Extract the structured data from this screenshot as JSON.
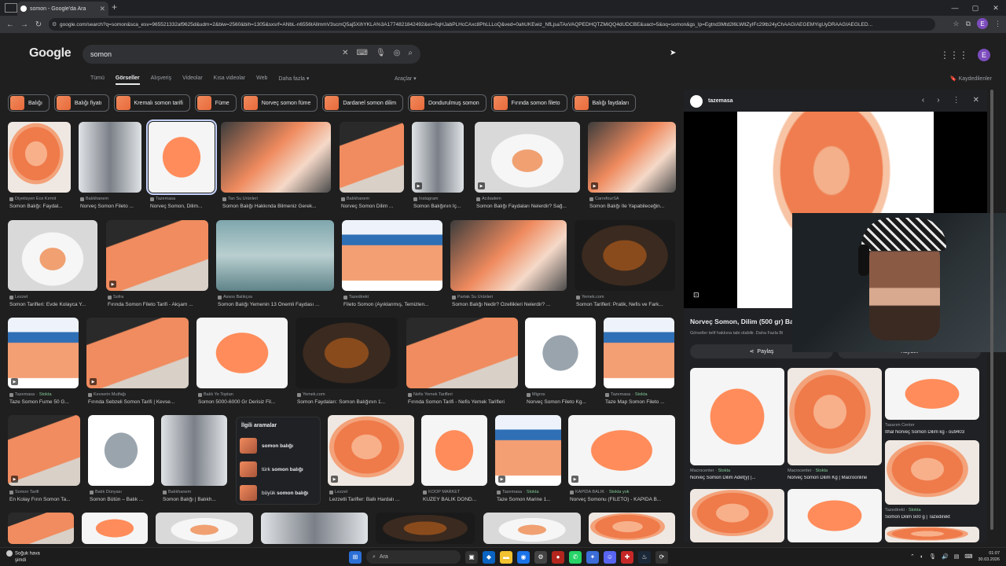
{
  "browser": {
    "tab_title": "somon - Google'da Ara",
    "url": "google.com/search?q=somon&sca_esv=965521332af9625d&udm=2&biw=2560&bih=1305&sxsrf=ANbL-n6556tAllmmV3scmQ5aj5XihYKLA%3A1774821842492&ei=0qHJabPLHcCAxc8PhLLLoQ&ved=0ahUKEwiz_NfLjsaTAxVAQPEDHQTZMiQQ4dUDCBE&uact=5&oq=somon&gs_lp=Egtnd3Mtd2l6LWltZyIFc29tb24yChAAGIAEGEMYigUyDRAAGIAEGLED...",
    "profile_initial": "E"
  },
  "header": {
    "logo": "Google",
    "query": "somon",
    "avatar_initial": "E"
  },
  "nav": {
    "tabs": [
      "Tümü",
      "Görseller",
      "Alışveriş",
      "Videolar",
      "Kısa videolar",
      "Web",
      "Daha fazla"
    ],
    "tools": "Araçlar",
    "saved": "Kaydedilenler"
  },
  "chips": [
    "Balığı",
    "Balığı fiyatı",
    "Kremalı somon tarifi",
    "Füme",
    "Norveç somon füme",
    "Dardanel somon dilim",
    "Dondurulmuş somon",
    "Fırında somon fileto",
    "Balığı faydaları"
  ],
  "results": [
    {
      "src": "Diyetisyen Ece Kırmit",
      "cap": "Somon Balığı: Faydal..."
    },
    {
      "src": "Balıkhanem",
      "cap": "Norveç Somon Fileto ..."
    },
    {
      "src": "Tazemasa",
      "cap": "Norveç Somon, Dilim..."
    },
    {
      "src": "Tan Su Ürünleri",
      "cap": "Somon Balığı Hakkında Bilmeniz Gerek..."
    },
    {
      "src": "Balıkhanem",
      "cap": "Norveç Somon Dilim ..."
    },
    {
      "src": "Instagram",
      "cap": "Somon Balığının İç..."
    },
    {
      "src": "Acıbadem",
      "cap": "Somon Balığı Faydaları Nelerdir? Sağ..."
    },
    {
      "src": "CarrefourSA",
      "cap": "Somon Balığı İle Yapabileceğin..."
    },
    {
      "src": "Lezzet",
      "cap": "Somon Tarifleri: Evde Kolayca Y..."
    },
    {
      "src": "Sofra",
      "cap": "Fırında Somon Fileto Tarifi - Akşam ..."
    },
    {
      "src": "Assos Balıkçısı",
      "cap": "Somon Balığı Yemenin 13 Önemli Faydası ..."
    },
    {
      "src": "Tazedirekt",
      "cap": "Fileto Somon (Ayıklanmış, Temizlen..."
    },
    {
      "src": "Partak Su Ürünleri",
      "cap": "Somon Balığı Nedir? Özellikleri Nelerdir? ..."
    },
    {
      "src": "Yemek.com",
      "cap": "Somon Tarifleri: Pratik, Nefis ve Fark..."
    },
    {
      "src": "Tazemasa",
      "stok": "Stokta",
      "cap": "Taze Somon Fume 50 G..."
    },
    {
      "src": "Kevserin Mutfağı",
      "cap": "Fırında Sebzeli Somon Tarifi | Kevse..."
    },
    {
      "src": "Balık Ye Toptan",
      "cap": "Somon 5000-6000 Gr Derisiz Fil..."
    },
    {
      "src": "Yemek.com",
      "cap": "Somon Faydaları: Somon Balığının 1..."
    },
    {
      "src": "Nefis Yemek Tarifleri",
      "cap": "Fırında Somon Tarifi - Nefis Yemek Tarifleri"
    },
    {
      "src": "Migros",
      "cap": "Norveç Somon Fileto Kg..."
    },
    {
      "src": "Tazemasa",
      "stok": "Stokta",
      "cap": "Taze Map Somon Fileto ..."
    },
    {
      "src": "Somon Tarifi",
      "cap": "En Kolay Fırın Somon Ta..."
    },
    {
      "src": "Balık Dünyası",
      "cap": "Somon Bütün – Balık ..."
    },
    {
      "src": "Balıkhanem",
      "cap": "Somon Balığı | Balıkh..."
    },
    {
      "src": "Lezzet",
      "cap": "Lezzetli Tarifler: Ballı Hardalı ..."
    },
    {
      "src": "KOOP MARKET",
      "cap": "KUZEY BALIK DOND..."
    },
    {
      "src": "Tazemasa",
      "stok": "Stokta",
      "cap": "Taze Somon Marine 1..."
    },
    {
      "src": "KAPIDA BALIK",
      "stok": "Stokta yok",
      "cap": "Norveç Somonu (FİLETO) - KAPIDA B..."
    }
  ],
  "related": {
    "heading": "İlgili aramalar",
    "items": [
      {
        "prefix": "",
        "bold": "somon balığı"
      },
      {
        "prefix": "türk ",
        "bold": "somon balığı"
      },
      {
        "prefix": "büyük ",
        "bold": "somon balığı"
      }
    ]
  },
  "panel": {
    "source": "tazemasa",
    "title": "Norveç Somon, Dilim (500 gr) Ba",
    "note": "Görseller telif hakkına tabi olabilir. Daha Fazla Bi",
    "share": "Paylaş",
    "save": "Kaydet",
    "related": [
      {
        "src": "Macrocenter",
        "stok": "Stokta",
        "cap": "Norveç Somon Dilim Adet(y) |..."
      },
      {
        "src": "Macrocenter",
        "stok": "Stokta",
        "cap": "Norveç Somon Dilim Kg | Macroonline"
      },
      {
        "src": "Tasarım Center",
        "stok": "",
        "cap": "İthal Norveç Somon Dilim kg - ou9403"
      },
      {
        "src": "Tazedirekt",
        "stok": "Stokta",
        "cap": "Somon Dilim 500 g | Tazedirekt"
      }
    ]
  },
  "taskbar": {
    "weather_title": "Soğuk hava",
    "weather_sub": "şimdi",
    "search": "Ara",
    "time": "01:07",
    "date": "30.03.2026"
  },
  "colors": {
    "accent": "#8ab4f8",
    "stock_green": "#81c995",
    "profile": "#7c4dbd"
  }
}
